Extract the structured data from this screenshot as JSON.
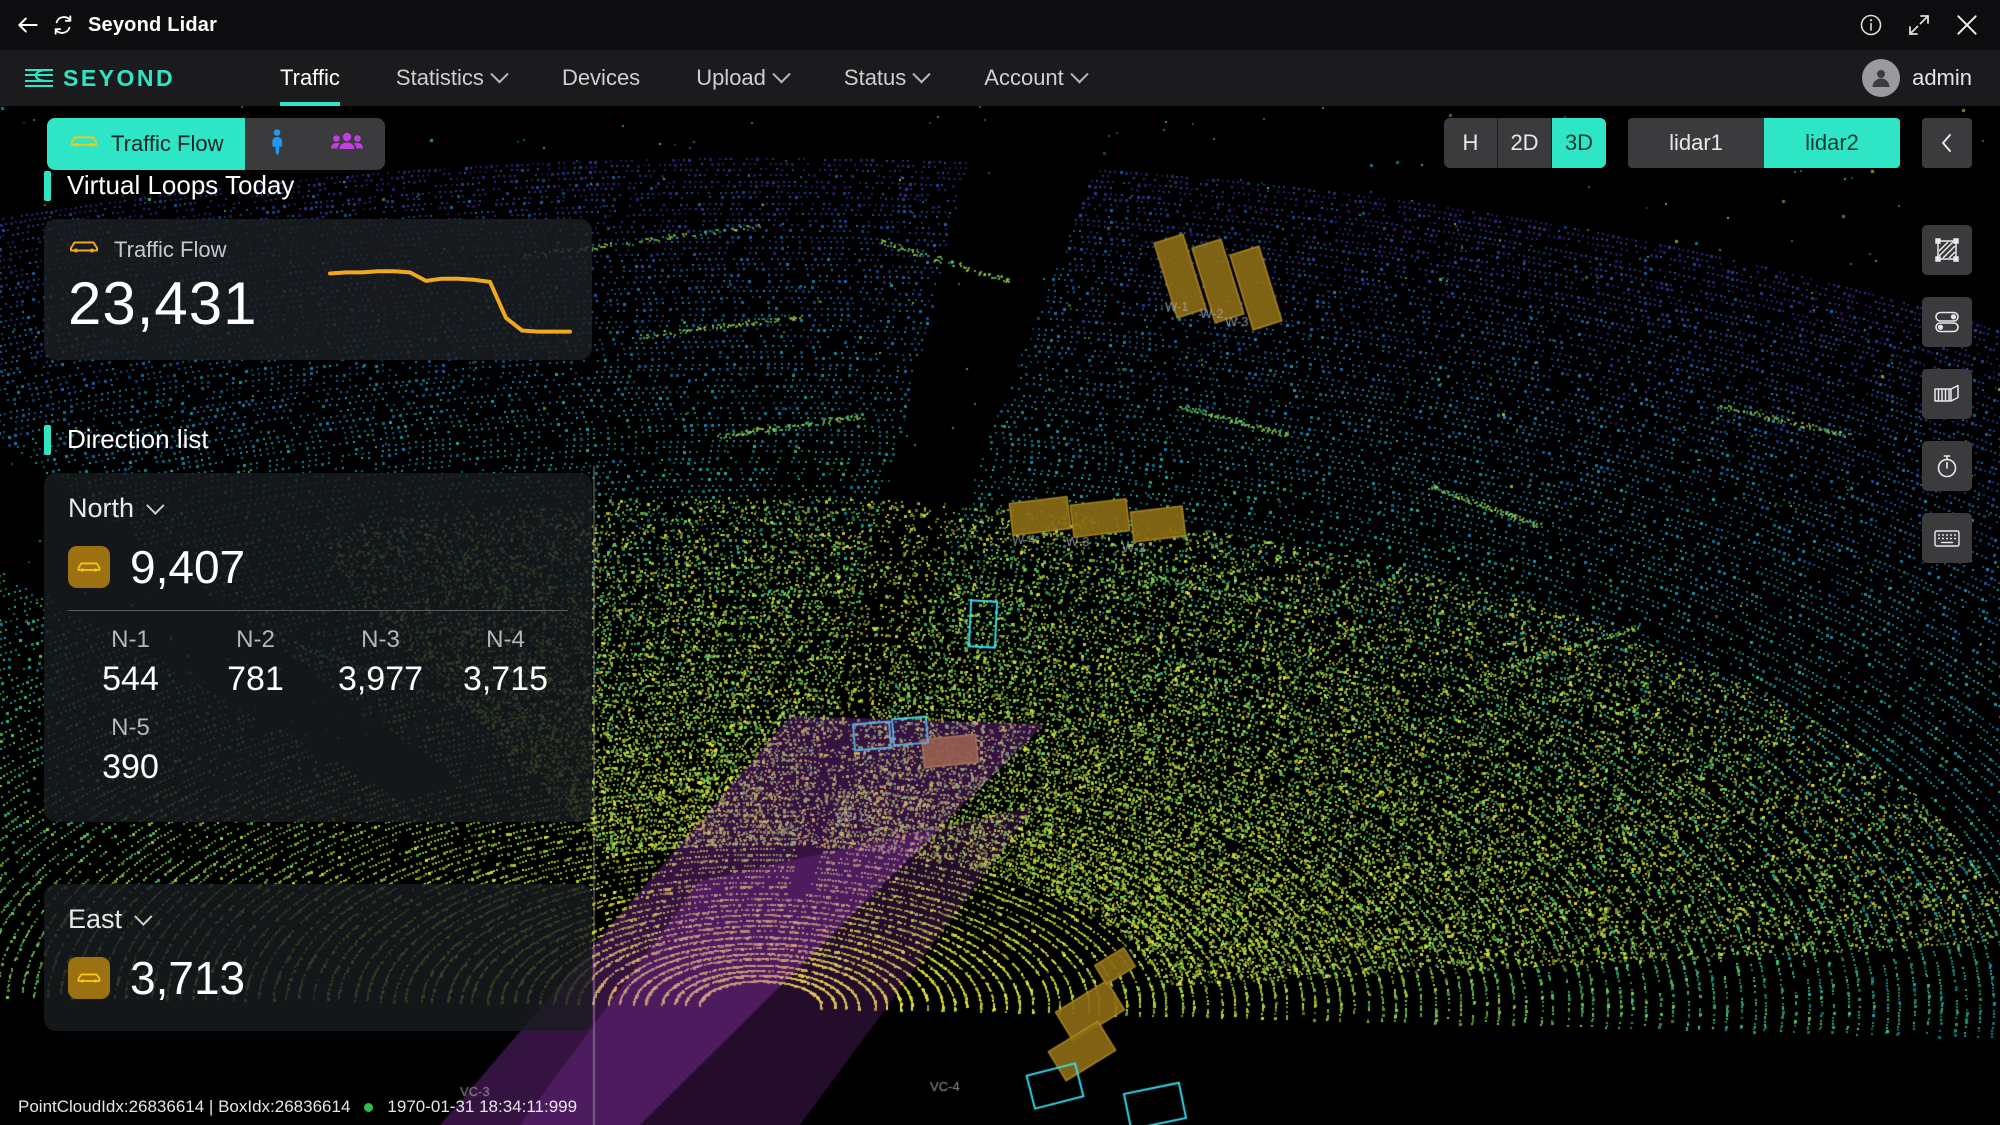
{
  "titlebar": {
    "title": "Seyond Lidar",
    "back_icon": "arrow-left-icon",
    "refresh_icon": "refresh-icon",
    "info_icon": "info-circle-icon",
    "fullscreen_icon": "fullscreen-icon",
    "close_icon": "close-icon"
  },
  "nav": {
    "brand": "SEYOND",
    "items": [
      {
        "label": "Traffic",
        "caret": false,
        "active": true
      },
      {
        "label": "Statistics",
        "caret": true,
        "active": false
      },
      {
        "label": "Devices",
        "caret": false,
        "active": false
      },
      {
        "label": "Upload",
        "caret": true,
        "active": false
      },
      {
        "label": "Status",
        "caret": true,
        "active": false
      },
      {
        "label": "Account",
        "caret": true,
        "active": false
      }
    ],
    "user": "admin",
    "avatar_icon": "user-avatar-icon"
  },
  "mode_toggle": {
    "segments": [
      {
        "label": "Traffic Flow",
        "icon": "car-icon",
        "active": true
      },
      {
        "label": "",
        "icon": "pedestrian-icon",
        "active": false
      },
      {
        "label": "",
        "icon": "crowd-icon",
        "active": false
      }
    ]
  },
  "panel": {
    "section_virtual_loops": "Virtual Loops Today",
    "section_direction_list": "Direction list",
    "flow_card": {
      "icon": "car-icon",
      "label": "Traffic Flow",
      "value": "23,431"
    },
    "directions": [
      {
        "name": "North",
        "total": "9,407",
        "lanes": [
          {
            "label": "N-1",
            "value": "544"
          },
          {
            "label": "N-2",
            "value": "781"
          },
          {
            "label": "N-3",
            "value": "3,977"
          },
          {
            "label": "N-4",
            "value": "3,715"
          },
          {
            "label": "N-5",
            "value": "390"
          }
        ]
      },
      {
        "name": "East",
        "total": "3,713",
        "lanes": []
      }
    ]
  },
  "view_controls": {
    "view_modes": [
      {
        "label": "H",
        "active": false
      },
      {
        "label": "2D",
        "active": false
      },
      {
        "label": "3D",
        "active": true
      }
    ],
    "lidars": [
      {
        "label": "lidar1",
        "active": false
      },
      {
        "label": "lidar2",
        "active": true
      }
    ],
    "collapse_icon": "chevron-left-icon"
  },
  "rail": [
    {
      "icon": "region-hatched-icon"
    },
    {
      "icon": "toggles-icon"
    },
    {
      "icon": "box-3d-icon"
    },
    {
      "icon": "stopwatch-icon"
    },
    {
      "icon": "keyboard-icon"
    }
  ],
  "status": {
    "indices": "PointCloudIdx:26836614 | BoxIdx:26836614",
    "timestamp": "1970-01-31 18:34:11:999",
    "status_dot_color": "#2fbf4a"
  },
  "theme": {
    "accent": "#2ee6c5",
    "amber": "#f0a81e",
    "pedestrian": "#2196f3",
    "crowd": "#c23ede",
    "panel_bg": "#1c2024"
  },
  "chart_data": {
    "type": "line",
    "title": "Traffic Flow sparkline",
    "series": [
      {
        "name": "Traffic Flow",
        "values": [
          62,
          63,
          63,
          64,
          64,
          63,
          55,
          57,
          57,
          56,
          54,
          20,
          8,
          7,
          7,
          7
        ]
      }
    ],
    "ylim": [
      0,
      70
    ],
    "grid": false,
    "color": "#f0a81e"
  }
}
